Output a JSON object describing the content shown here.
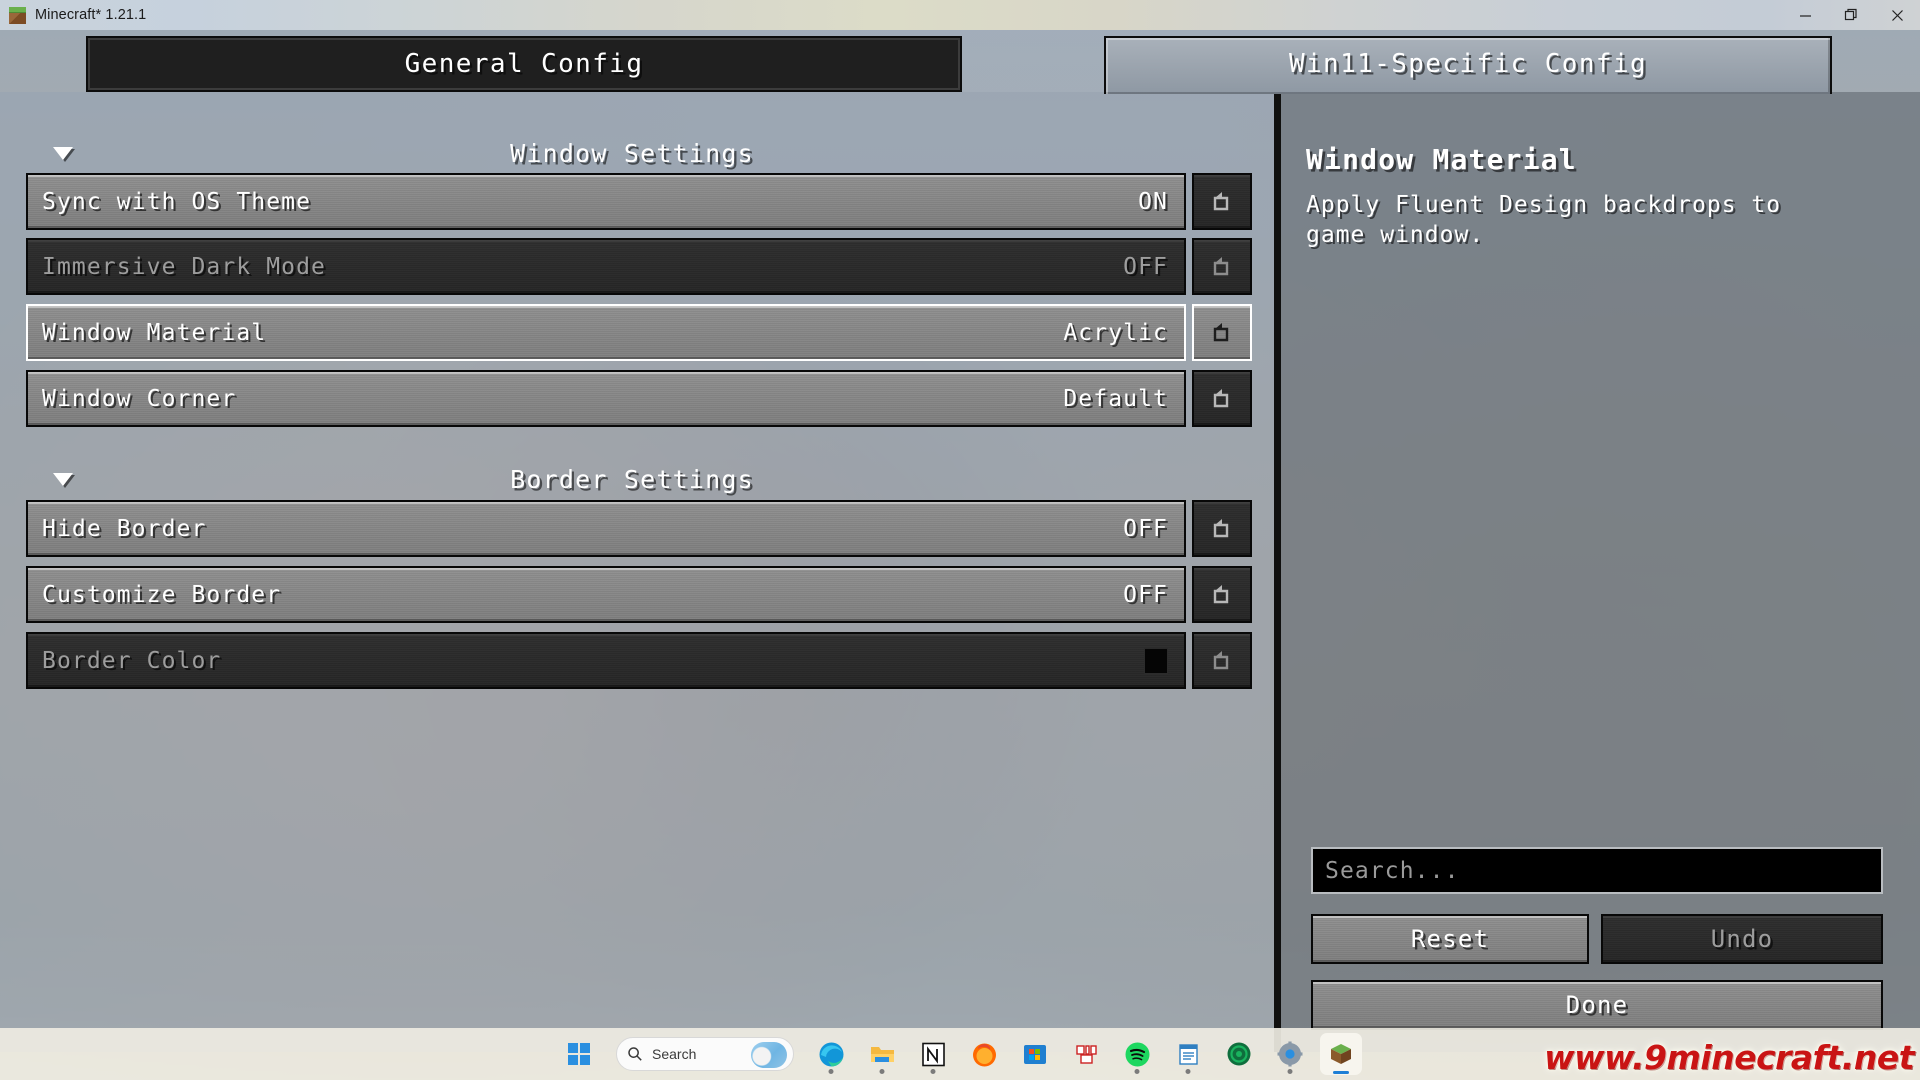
{
  "window": {
    "title": "Minecraft* 1.21.1",
    "icon": "minecraft-grass-block-icon",
    "minimize": "—",
    "restore": "❐",
    "close": "×"
  },
  "tabs": [
    {
      "label": "General Config",
      "selected": false
    },
    {
      "label": "Win11-Specific Config",
      "selected": true
    }
  ],
  "categories": [
    {
      "label": "Window Settings",
      "expanded": true,
      "rows": [
        {
          "name": "Sync with OS Theme",
          "value": "ON",
          "state": "enabled",
          "highlighted": false,
          "reset": "reset-icon"
        },
        {
          "name": "Immersive Dark Mode",
          "value": "OFF",
          "state": "disabled",
          "highlighted": false,
          "reset": "reset-icon"
        },
        {
          "name": "Window Material",
          "value": "Acrylic",
          "state": "enabled",
          "highlighted": true,
          "reset": "reset-icon"
        },
        {
          "name": "Window Corner",
          "value": "Default",
          "state": "enabled",
          "highlighted": false,
          "reset": "reset-icon"
        }
      ]
    },
    {
      "label": "Border Settings",
      "expanded": true,
      "rows": [
        {
          "name": "Hide Border",
          "value": "OFF",
          "state": "enabled",
          "highlighted": false,
          "reset": "reset-icon"
        },
        {
          "name": "Customize Border",
          "value": "OFF",
          "state": "enabled",
          "highlighted": false,
          "reset": "reset-icon"
        },
        {
          "name": "Border Color",
          "value": "",
          "swatch": "#050505",
          "state": "disabled",
          "highlighted": false,
          "reset": "reset-icon"
        }
      ]
    }
  ],
  "description": {
    "title": "Window Material",
    "body": "Apply Fluent Design backdrops to game window."
  },
  "search": {
    "placeholder": "Search...",
    "value": ""
  },
  "buttons": {
    "reset": "Reset",
    "undo": "Undo",
    "done": "Done"
  },
  "taskbar": {
    "search_label": "Search",
    "items": [
      "windows-start-icon",
      "taskbar-search-box",
      "microsoft-edge-icon",
      "file-explorer-icon",
      "notion-icon",
      "firefox-icon",
      "microsoft-store-icon",
      "unknown-app-icon",
      "spotify-icon",
      "notepad-icon",
      "app-green-circle-icon",
      "settings-gear-icon",
      "minecraft-launcher-icon"
    ]
  },
  "watermark": "www.9minecraft.net",
  "colors": {
    "tab_selected_bg": "#9aa3ad",
    "tab_unselected_bg": "#1f1f1f",
    "left_pane_bg": "#9aa5b2",
    "right_pane_bg": "#767d85",
    "row_enabled": "#868686",
    "row_disabled": "#2a2a2a",
    "text_light": "#ffffff",
    "text_dim": "#9d9d9d",
    "highlight_border": "#ffffff",
    "watermark_red": "#c91414"
  }
}
